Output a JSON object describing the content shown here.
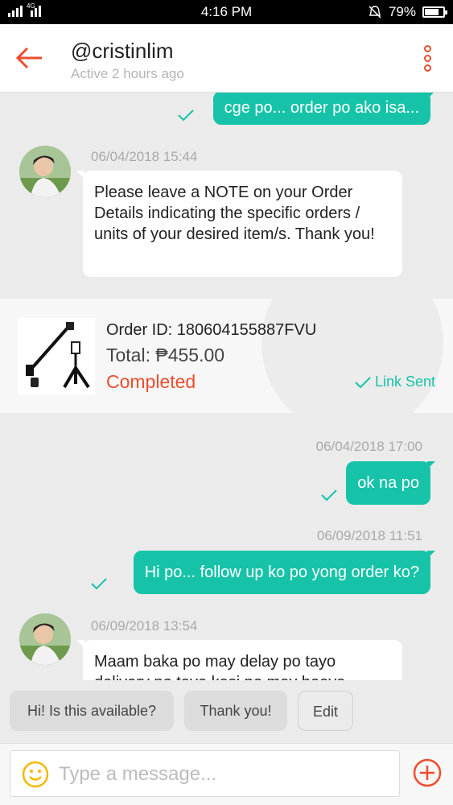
{
  "status_bar": {
    "time": "4:16 PM",
    "network": "4G",
    "battery": "79%",
    "battery_level": 0.79,
    "icons": [
      "signal-icon",
      "silent-icon",
      "battery-icon"
    ]
  },
  "header": {
    "title": "@cristinlim",
    "subtitle": "Active 2 hours ago",
    "icons": [
      "back-arrow-icon",
      "more-vertical-icon"
    ],
    "accent_color": "#ee4d2d"
  },
  "messages": [
    {
      "type": "outgoing",
      "text": "cge po... order po ako isa..."
    },
    {
      "type": "incoming",
      "timestamp": "06/04/2018 15:44",
      "text": "Please leave a NOTE on your Order Details indicating the specific orders / units of your desired item/s. Thank you!"
    },
    {
      "type": "order",
      "order_id": "Order ID: 180604155887FVU",
      "total": "Total: ₱455.00",
      "status": "Completed",
      "link_status": "Link Sent"
    },
    {
      "type": "outgoing",
      "timestamp": "06/04/2018 17:00",
      "text": "ok na po"
    },
    {
      "type": "outgoing",
      "timestamp": "06/09/2018 11:51",
      "text": "Hi po... follow up ko po yong order ko?"
    },
    {
      "type": "incoming",
      "timestamp": "06/09/2018 13:54",
      "text": "Maam baka po may delay po tayo delivery po tayo kasi po may beaya"
    }
  ],
  "quick_replies": [
    "Hi! Is this available?",
    "Thank you!",
    "Edit"
  ],
  "composer": {
    "placeholder": "Type a message...",
    "icons": [
      "emoji-icon",
      "add-icon"
    ]
  },
  "colors": {
    "accent": "#ee4d2d",
    "outgoing_bubble": "#16c3a8",
    "background": "#ebebeb"
  }
}
